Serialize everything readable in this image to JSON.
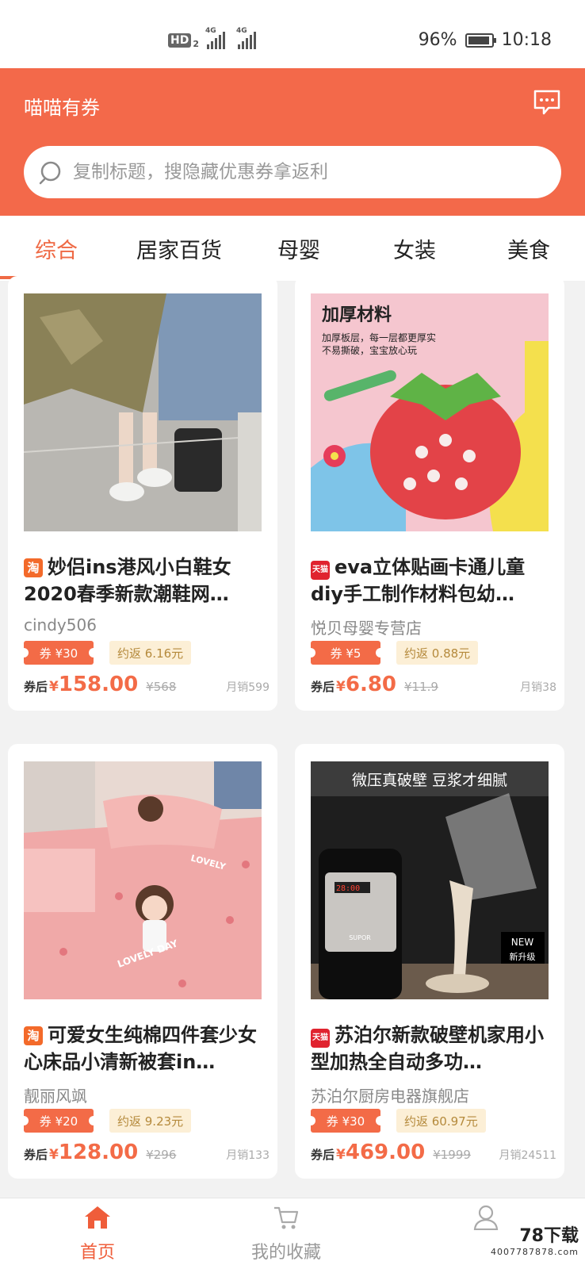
{
  "status_bar": {
    "hd": "HD",
    "sim": "2",
    "net1": "4G",
    "net2": "4G",
    "battery": "96%",
    "time": "10:18",
    "battery_level": 0.96
  },
  "header": {
    "app_title": "喵喵有券",
    "message_icon": "chat-bubble-icon"
  },
  "search": {
    "placeholder": "复制标题，搜隐藏优惠券拿返利"
  },
  "tabs": [
    "综合",
    "居家百货",
    "母婴",
    "女装",
    "美食"
  ],
  "active_tab": 0,
  "products": [
    {
      "platform": "淘",
      "title": "妙侣ins港风小白鞋女2020春季新款潮鞋网…",
      "shop": "cindy506",
      "coupon": "券 ¥30",
      "rebate": "约返  6.16元",
      "after_label": "券后",
      "yen": "¥",
      "price": "158.00",
      "original": "¥568",
      "sales": "月销599"
    },
    {
      "platform": "天猫",
      "title": "eva立体贴画卡通儿童diy手工制作材料包幼…",
      "shop": "悦贝母婴专营店",
      "coupon": "券 ¥5",
      "rebate": "约返  0.88元",
      "after_label": "券后",
      "yen": "¥",
      "price": "6.80",
      "original": "¥11.9",
      "sales": "月销38",
      "image_text": {
        "heading": "加厚材料",
        "line1": "加厚板层，每一层都更厚实",
        "line2": "不易撕破，宝宝放心玩"
      }
    },
    {
      "platform": "淘",
      "title": "可爱女生纯棉四件套少女心床品小清新被套in…",
      "shop": "靓丽风飒",
      "coupon": "券 ¥20",
      "rebate": "约返  9.23元",
      "after_label": "券后",
      "yen": "¥",
      "price": "128.00",
      "original": "¥296",
      "sales": "月销133",
      "image_text": {
        "pillow1": "LOVELY DAY",
        "pillow2": "LOVELY"
      }
    },
    {
      "platform": "天猫",
      "title": "苏泊尔新款破壁机家用小型加热全自动多功…",
      "shop": "苏泊尔厨房电器旗舰店",
      "coupon": "券 ¥30",
      "rebate": "约返  60.97元",
      "after_label": "券后",
      "yen": "¥",
      "price": "469.00",
      "original": "¥1999",
      "sales": "月销24511",
      "image_text": {
        "banner": "微压真破壁  豆浆才细腻",
        "badge_en": "NEW",
        "badge_cn": "新升级",
        "display": "28:00",
        "brand": "SUPOR"
      }
    }
  ],
  "bottom_nav": [
    {
      "label": "首页",
      "icon": "home-icon",
      "active": true
    },
    {
      "label": "我的收藏",
      "icon": "cart-icon",
      "active": false
    },
    {
      "label": "",
      "icon": "user-icon",
      "active": false
    }
  ],
  "watermark": {
    "logo_text": "78下载",
    "sub": "4007787878.com"
  },
  "colors": {
    "brand": "#f3694a",
    "accent": "#ef6a45",
    "rebate_bg": "#fcefd6",
    "tmall": "#e0232f",
    "taobao": "#f36a2a"
  }
}
